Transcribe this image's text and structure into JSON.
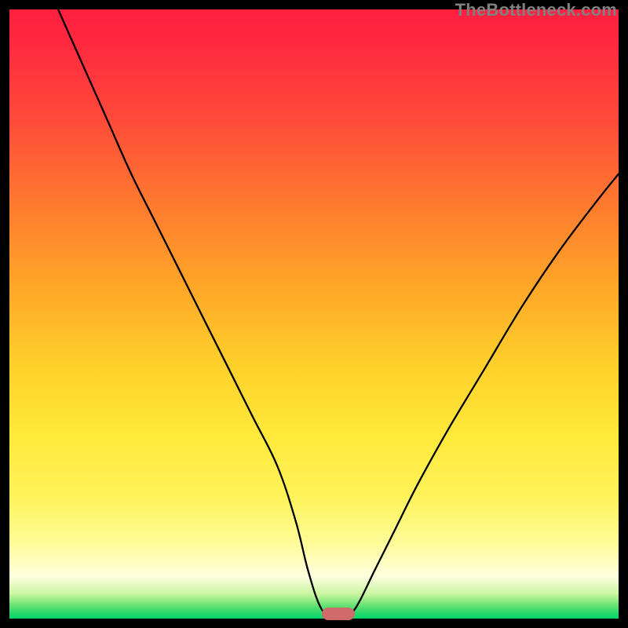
{
  "attribution": "TheBottleneck.com",
  "colors": {
    "page_bg": "#000000",
    "gradient_top": "#ff1f3f",
    "gradient_mid": "#ffe93a",
    "gradient_bottom": "#00d46a",
    "curve_stroke": "#000000",
    "marker_fill": "#cf6b6b",
    "attribution_text": "#808080"
  },
  "chart_data": {
    "type": "line",
    "title": "",
    "xlabel": "",
    "ylabel": "",
    "xlim": [
      0,
      100
    ],
    "ylim": [
      0,
      100
    ],
    "grid": false,
    "legend": false,
    "series": [
      {
        "name": "bottleneck-curve",
        "x": [
          8,
          12,
          16,
          20,
          24,
          28,
          32,
          36,
          40,
          44,
          47,
          49,
          51,
          53,
          55,
          57,
          60,
          63,
          67,
          72,
          78,
          84,
          90,
          96,
          100
        ],
        "y": [
          100,
          91,
          82,
          73,
          65,
          57,
          49,
          41,
          33,
          25,
          16,
          8,
          2,
          0,
          0,
          2,
          8,
          14,
          22,
          31,
          41,
          51,
          60,
          68,
          73
        ]
      }
    ],
    "marker": {
      "x": 54,
      "y": 0,
      "shape": "pill"
    },
    "notes": "Single V-shaped curve on a vertical red→yellow→green gradient; minimum (≈0) near x≈53–55; no axis ticks or labels are rendered."
  }
}
